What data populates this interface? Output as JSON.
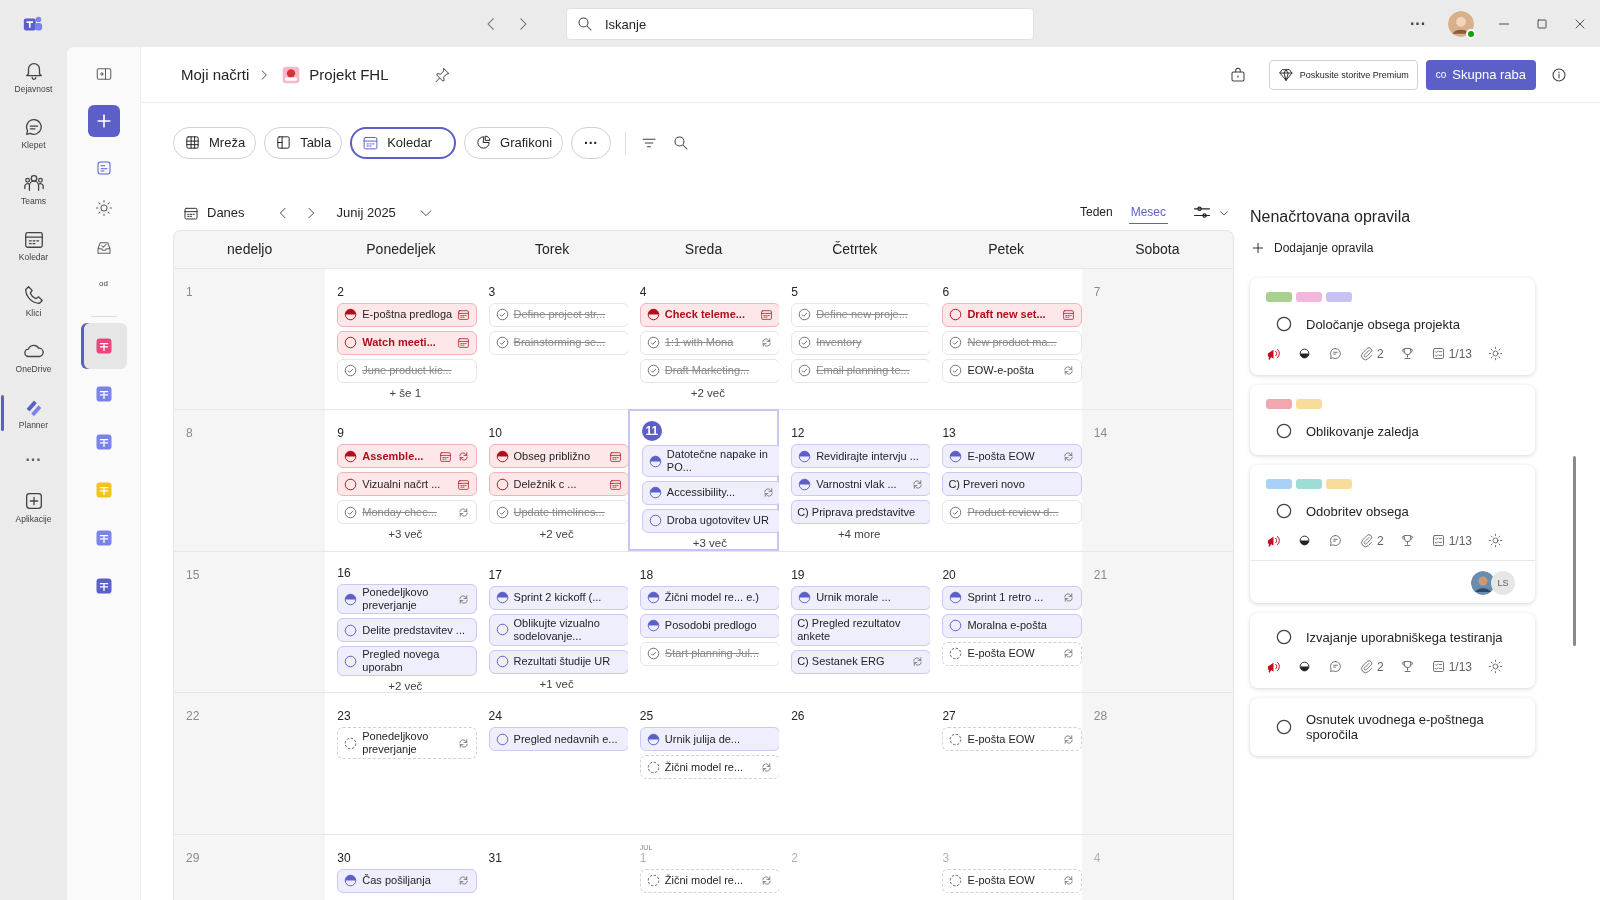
{
  "topbar": {
    "search": {
      "placeholder": "Iskanje"
    },
    "more": "···"
  },
  "rail": {
    "items": [
      {
        "label": "Dejavnost",
        "selected": false
      },
      {
        "label": "Klepet",
        "selected": false
      },
      {
        "label": "Teams",
        "selected": false
      },
      {
        "label": "Koledar",
        "selected": false
      },
      {
        "label": "Klici",
        "selected": false
      },
      {
        "label": "OneDrive",
        "selected": false
      },
      {
        "label": "Planner",
        "selected": true
      }
    ],
    "more": "···",
    "apps": "Aplikacije"
  },
  "sidebar": {
    "label": "od",
    "plans": [
      {
        "selected": true
      },
      {
        "selected": false
      },
      {
        "selected": false
      },
      {
        "selected": false
      },
      {
        "selected": false
      },
      {
        "selected": false
      }
    ]
  },
  "header": {
    "breadcrumb": "Moji načrti",
    "plan": "Projekt FHL",
    "premium": "Poskusite storitve Premium",
    "share_badge": "co",
    "share": "Skupna raba"
  },
  "views": [
    {
      "label": "Mreža",
      "selected": false
    },
    {
      "label": "Tabla",
      "selected": false
    },
    {
      "label": "Koledar",
      "selected": true
    },
    {
      "label": "Grafikoni",
      "selected": false
    }
  ],
  "views_more": "···",
  "calendar": {
    "today": "Danes",
    "month": "Junij 2025",
    "modes": [
      {
        "label": "Teden",
        "selected": false
      },
      {
        "label": "Mesec",
        "selected": true
      }
    ],
    "weekdays": [
      "nedeljo",
      "Ponedeljek",
      "Torek",
      "Sreda",
      "Četrtek",
      "Petek",
      "Sobota"
    ],
    "weeks": [
      [
        {
          "date": "1",
          "today": false,
          "outside": false
        },
        {
          "date": "2",
          "today": false,
          "outside": false,
          "more": "+ še 1",
          "tasks": [
            {
              "title": "E-poštna predloga",
              "kind": "half",
              "overdue": true,
              "bold": false,
              "calendar": true,
              "repeat": false
            },
            {
              "title": "Watch meeti...",
              "kind": "open",
              "overdue": true,
              "bold": true,
              "calendar": true,
              "repeat": false
            },
            {
              "title": "June product kic...",
              "kind": "done",
              "overdue": false,
              "bold": false,
              "calendar": false,
              "repeat": false
            }
          ]
        },
        {
          "date": "3",
          "today": false,
          "outside": false,
          "tasks": [
            {
              "title": "Define project str...",
              "kind": "done",
              "overdue": false,
              "bold": false,
              "calendar": false,
              "repeat": false
            },
            {
              "title": "Brainstorming se...",
              "kind": "done",
              "overdue": false,
              "bold": false,
              "calendar": false,
              "repeat": false
            }
          ]
        },
        {
          "date": "4",
          "today": false,
          "outside": false,
          "more": "+2 več",
          "tasks": [
            {
              "title": "Check teleme...",
              "kind": "half",
              "overdue": true,
              "bold": true,
              "calendar": true,
              "repeat": false
            },
            {
              "title": "1:1 with Mona",
              "kind": "done",
              "overdue": false,
              "bold": false,
              "calendar": false,
              "repeat": true
            },
            {
              "title": "Draft Marketing...",
              "kind": "done",
              "overdue": false,
              "bold": false,
              "calendar": false,
              "repeat": false
            }
          ]
        },
        {
          "date": "5",
          "today": false,
          "outside": false,
          "tasks": [
            {
              "title": "Define new proje...",
              "kind": "done",
              "overdue": false,
              "bold": false,
              "calendar": false,
              "repeat": false
            },
            {
              "title": "Inventory",
              "kind": "done",
              "overdue": false,
              "bold": false,
              "calendar": false,
              "repeat": false
            },
            {
              "title": "Email planning te...",
              "kind": "done",
              "overdue": false,
              "bold": false,
              "calendar": false,
              "repeat": false
            }
          ]
        },
        {
          "date": "6",
          "today": false,
          "outside": false,
          "tasks": [
            {
              "title": "Draft new set...",
              "kind": "open",
              "overdue": true,
              "bold": true,
              "calendar": true,
              "repeat": false
            },
            {
              "title": "New product ma...",
              "kind": "done",
              "overdue": false,
              "bold": false,
              "calendar": false,
              "repeat": false
            },
            {
              "title": "EOW-e-pošta",
              "kind": "check",
              "overdue": false,
              "bold": false,
              "calendar": false,
              "repeat": true
            }
          ]
        },
        {
          "date": "7",
          "today": false,
          "outside": false
        }
      ],
      [
        {
          "date": "8",
          "today": false,
          "outside": false
        },
        {
          "date": "9",
          "today": false,
          "outside": false,
          "more": "+3 več",
          "tasks": [
            {
              "title": "Assemble...",
              "kind": "half",
              "overdue": true,
              "bold": true,
              "calendar": true,
              "repeat": true
            },
            {
              "title": "Vizualni načrt ...",
              "kind": "open",
              "overdue": true,
              "bold": false,
              "calendar": true,
              "repeat": false
            },
            {
              "title": "Monday chec...",
              "kind": "done",
              "overdue": false,
              "bold": false,
              "calendar": false,
              "repeat": true
            }
          ]
        },
        {
          "date": "10",
          "today": false,
          "outside": false,
          "more": "+2 več",
          "tasks": [
            {
              "title": "Obseg približno",
              "kind": "half",
              "overdue": true,
              "bold": false,
              "calendar": true,
              "repeat": false
            },
            {
              "title": "Deležnik c ...",
              "kind": "open",
              "overdue": true,
              "bold": false,
              "calendar": true,
              "repeat": false
            },
            {
              "title": "Update timelines...",
              "kind": "done",
              "overdue": false,
              "bold": false,
              "calendar": false,
              "repeat": false
            }
          ]
        },
        {
          "date": "11",
          "today": true,
          "outside": false,
          "more": "+3 več",
          "tasks": [
            {
              "title": "Datotečne napake in PO...",
              "kind": "half",
              "overdue": false,
              "bold": false,
              "calendar": false,
              "repeat": false
            },
            {
              "title": "Accessibility...",
              "kind": "half",
              "overdue": false,
              "bold": false,
              "calendar": false,
              "repeat": true
            },
            {
              "title": "Droba ugotovitev UR",
              "kind": "open",
              "overdue": false,
              "bold": false,
              "calendar": false,
              "repeat": false
            }
          ]
        },
        {
          "date": "12",
          "today": false,
          "outside": false,
          "more": "+4 more",
          "tasks": [
            {
              "title": "Revidirajte intervju ...",
              "kind": "half",
              "overdue": false,
              "bold": false,
              "calendar": false,
              "repeat": false
            },
            {
              "title": "Varnostni vlak ...",
              "kind": "half",
              "overdue": false,
              "bold": false,
              "calendar": false,
              "repeat": true
            },
            {
              "title": "C) Priprava predstavitve",
              "kind": "text",
              "overdue": false,
              "bold": false,
              "calendar": false,
              "repeat": false
            }
          ]
        },
        {
          "date": "13",
          "today": false,
          "outside": false,
          "tasks": [
            {
              "title": "E-pošta EOW",
              "kind": "half",
              "overdue": false,
              "bold": false,
              "calendar": false,
              "repeat": true
            },
            {
              "title": "C) Preveri novo",
              "kind": "text",
              "overdue": false,
              "bold": false,
              "calendar": false,
              "repeat": false
            },
            {
              "title": "Product review d...",
              "kind": "done",
              "overdue": false,
              "bold": false,
              "calendar": false,
              "repeat": false
            }
          ]
        },
        {
          "date": "14",
          "today": false,
          "outside": false
        }
      ],
      [
        {
          "date": "15",
          "today": false,
          "outside": false
        },
        {
          "date": "16",
          "today": false,
          "outside": false,
          "more": "+2 več",
          "tasks": [
            {
              "title": "Ponedeljkovo preverjanje",
              "kind": "half",
              "overdue": false,
              "bold": false,
              "calendar": false,
              "repeat": true
            },
            {
              "title": "Delite predstavitev ...",
              "kind": "open",
              "overdue": false,
              "bold": false,
              "calendar": false,
              "repeat": false
            },
            {
              "title": "Pregled novega uporabn",
              "kind": "open",
              "overdue": false,
              "bold": false,
              "calendar": false,
              "repeat": false
            }
          ]
        },
        {
          "date": "17",
          "today": false,
          "outside": false,
          "more": "+1 več",
          "tasks": [
            {
              "title": "Sprint 2 kickoff (...",
              "kind": "half",
              "overdue": false,
              "bold": false,
              "calendar": false,
              "repeat": false
            },
            {
              "title": "Oblikujte vizualno sodelovanje...",
              "kind": "open",
              "overdue": false,
              "bold": false,
              "calendar": false,
              "repeat": false
            },
            {
              "title": "Rezultati študije UR",
              "kind": "open",
              "overdue": false,
              "bold": false,
              "calendar": false,
              "repeat": false
            }
          ]
        },
        {
          "date": "18",
          "today": false,
          "outside": false,
          "tasks": [
            {
              "title": "Žični model re... e.)",
              "kind": "half",
              "overdue": false,
              "bold": false,
              "calendar": false,
              "repeat": false
            },
            {
              "title": "Posodobi predlogo",
              "kind": "half",
              "overdue": false,
              "bold": false,
              "calendar": false,
              "repeat": false
            },
            {
              "title": "Start planning Jul...",
              "kind": "done",
              "overdue": false,
              "bold": false,
              "calendar": false,
              "repeat": false
            }
          ]
        },
        {
          "date": "19",
          "today": false,
          "outside": false,
          "tasks": [
            {
              "title": "Urnik morale ...",
              "kind": "half",
              "overdue": false,
              "bold": false,
              "calendar": false,
              "repeat": false
            },
            {
              "title": "C) Pregled rezultatov ankete",
              "kind": "text",
              "overdue": false,
              "bold": false,
              "calendar": false,
              "repeat": false
            },
            {
              "title": "C) Sestanek ERG",
              "kind": "text",
              "overdue": false,
              "bold": false,
              "calendar": false,
              "repeat": true
            }
          ]
        },
        {
          "date": "20",
          "today": false,
          "outside": false,
          "tasks": [
            {
              "title": "Sprint 1 retro ...",
              "kind": "half",
              "overdue": false,
              "bold": false,
              "calendar": false,
              "repeat": true
            },
            {
              "title": "Moralna e-pošta",
              "kind": "open",
              "overdue": false,
              "bold": false,
              "calendar": false,
              "repeat": false
            },
            {
              "title": "E-pošta EOW",
              "kind": "pending",
              "overdue": false,
              "bold": false,
              "calendar": false,
              "repeat": true
            }
          ]
        },
        {
          "date": "21",
          "today": false,
          "outside": false
        }
      ],
      [
        {
          "date": "22",
          "today": false,
          "outside": false
        },
        {
          "date": "23",
          "today": false,
          "outside": false,
          "tasks": [
            {
              "title": "Ponedeljkovo preverjanje",
              "kind": "pending",
              "overdue": false,
              "bold": false,
              "calendar": false,
              "repeat": true
            }
          ]
        },
        {
          "date": "24",
          "today": false,
          "outside": false,
          "tasks": [
            {
              "title": "Pregled nedavnih e...",
              "kind": "open",
              "overdue": false,
              "bold": false,
              "calendar": false,
              "repeat": false
            }
          ]
        },
        {
          "date": "25",
          "today": false,
          "outside": false,
          "tasks": [
            {
              "title": "Urnik julija de...",
              "kind": "half",
              "overdue": false,
              "bold": false,
              "calendar": false,
              "repeat": false
            },
            {
              "title": "Žični model re...",
              "kind": "pending",
              "overdue": false,
              "bold": false,
              "calendar": false,
              "repeat": true
            }
          ]
        },
        {
          "date": "26",
          "today": false,
          "outside": false
        },
        {
          "date": "27",
          "today": false,
          "outside": false,
          "tasks": [
            {
              "title": "E-pošta EOW",
              "kind": "pending",
              "overdue": false,
              "bold": false,
              "calendar": false,
              "repeat": true
            }
          ]
        },
        {
          "date": "28",
          "today": false,
          "outside": false
        }
      ],
      [
        {
          "date": "29",
          "today": false,
          "outside": false
        },
        {
          "date": "30",
          "today": false,
          "outside": false,
          "tasks": [
            {
              "title": "Čas pošiljanja",
              "kind": "half",
              "overdue": false,
              "bold": false,
              "calendar": false,
              "repeat": true
            }
          ]
        },
        {
          "date": "31",
          "today": false,
          "outside": false
        },
        {
          "date": "1",
          "month": "JUL",
          "today": false,
          "outside": true,
          "tasks": [
            {
              "title": "Žični model re...",
              "kind": "pending",
              "overdue": false,
              "bold": false,
              "calendar": false,
              "repeat": true
            }
          ]
        },
        {
          "date": "2",
          "today": false,
          "outside": true
        },
        {
          "date": "3",
          "today": false,
          "outside": true,
          "tasks": [
            {
              "title": "E-pošta EOW",
              "kind": "pending",
              "overdue": false,
              "bold": false,
              "calendar": false,
              "repeat": true
            }
          ]
        },
        {
          "date": "4",
          "today": false,
          "outside": true
        }
      ]
    ]
  },
  "unscheduled": {
    "title": "Nenačrtovana opravila",
    "add": "Dodajanje opravila",
    "cards": [
      {
        "labels": [
          {
            "color": "#a9d18e"
          },
          {
            "color": "#f4b6dc"
          },
          {
            "color": "#c5c3f4"
          }
        ],
        "title": "Določanje obsega projekta",
        "meta": {
          "attachments": "2",
          "checklist": "1/13"
        }
      },
      {
        "labels": [
          {
            "color": "#eea8ae"
          },
          {
            "color": "#f8dc9c"
          }
        ],
        "title": "Oblikovanje zaledja"
      },
      {
        "labels": [
          {
            "color": "#a9d0f5"
          },
          {
            "color": "#9fdcd5"
          },
          {
            "color": "#f8dc9c"
          }
        ],
        "title": "Odobritev obsega",
        "meta": {
          "attachments": "2",
          "checklist": "1/13"
        },
        "assignees": [
          {
            "kind": "photo"
          },
          {
            "kind": "initials",
            "initials": "LS"
          }
        ]
      },
      {
        "title": "Izvajanje uporabniškega testiranja",
        "meta": {
          "attachments": "2",
          "checklist": "1/13"
        }
      },
      {
        "title": "Osnutek uvodnega e-poštnega sporočila"
      }
    ]
  }
}
